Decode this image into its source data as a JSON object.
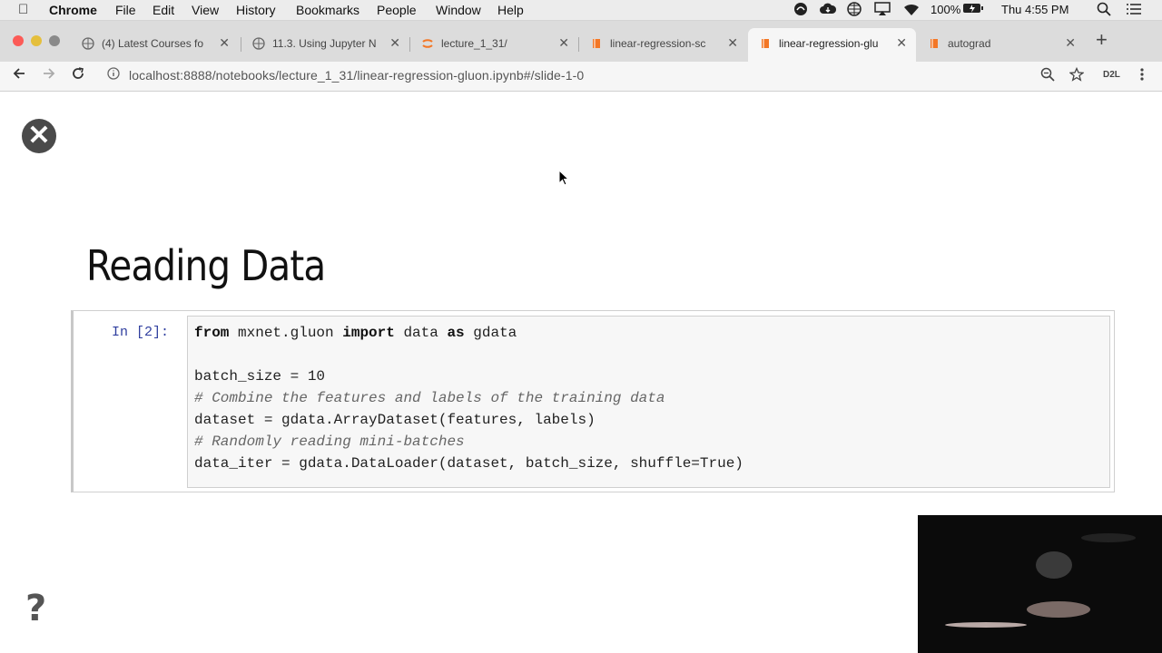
{
  "menubar": {
    "apple_icon": "apple-logo",
    "app_name": "Chrome",
    "menus": [
      "File",
      "Edit",
      "View",
      "History",
      "Bookmarks",
      "People",
      "Window",
      "Help"
    ],
    "battery": "100%",
    "clock": "Thu 4:55 PM",
    "status_icons": [
      "creative-cloud-icon",
      "cloud-icon",
      "globe-icon",
      "airplay-icon",
      "wifi-icon",
      "battery-icon",
      "search-icon",
      "list-icon"
    ]
  },
  "tabs": [
    {
      "title": "(4) Latest Courses fo",
      "favicon": "globe-icon",
      "active": false
    },
    {
      "title": "11.3. Using Jupyter N",
      "favicon": "globe-icon",
      "active": false
    },
    {
      "title": "lecture_1_31/",
      "favicon": "jupyter-icon",
      "active": false
    },
    {
      "title": "linear-regression-sc",
      "favicon": "book-icon",
      "active": false
    },
    {
      "title": "linear-regression-glu",
      "favicon": "book-icon",
      "active": true
    },
    {
      "title": "autograd",
      "favicon": "book-icon",
      "active": false
    }
  ],
  "toolbar": {
    "url": "localhost:8888/notebooks/lecture_1_31/linear-regression-gluon.ipynb#/slide-1-0",
    "extension_label": "D2L"
  },
  "slide": {
    "heading": "Reading Data",
    "prompt": "In [2]:",
    "code_lines": [
      [
        {
          "t": "from",
          "k": "kw"
        },
        {
          "t": " mxnet.gluon ",
          "k": ""
        },
        {
          "t": "import",
          "k": "kw"
        },
        {
          "t": " data ",
          "k": ""
        },
        {
          "t": "as",
          "k": "kw"
        },
        {
          "t": " gdata",
          "k": ""
        }
      ],
      [],
      [
        {
          "t": "batch_size = 10",
          "k": ""
        }
      ],
      [
        {
          "t": "# Combine the features and labels of the training data",
          "k": "cm"
        }
      ],
      [
        {
          "t": "dataset = gdata.ArrayDataset(features, labels)",
          "k": ""
        }
      ],
      [
        {
          "t": "# Randomly reading mini-batches",
          "k": "cm"
        }
      ],
      [
        {
          "t": "data_iter = gdata.DataLoader(dataset, batch_size, shuffle=True)",
          "k": ""
        }
      ]
    ]
  },
  "colors": {
    "menubar_bg": "#ececec",
    "tabstrip_bg": "#dcdcdc",
    "active_tab_bg": "#f6f6f6",
    "code_bg": "#f7f7f7",
    "prompt_color": "#303f9f",
    "traffic_red": "#fc5b57",
    "traffic_yellow": "#e5bf3c",
    "traffic_gray": "#8a8a8a"
  }
}
